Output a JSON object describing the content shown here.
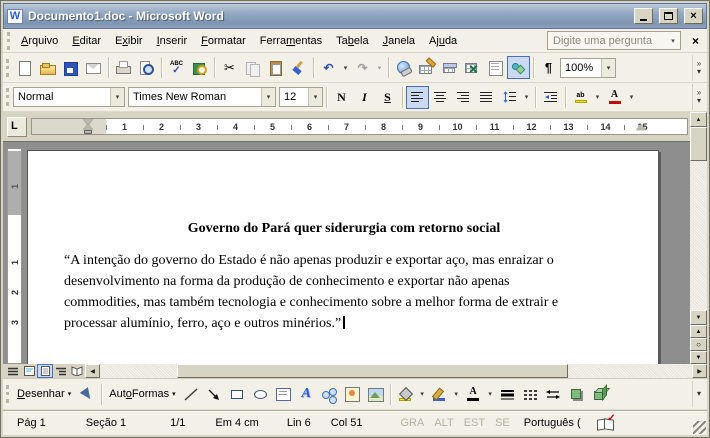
{
  "window": {
    "title": "Documento1.doc - Microsoft Word"
  },
  "icons": {
    "word_logo": "W",
    "close": "×",
    "dropdown": "▾",
    "overflow_chevron": "»",
    "cut": "✂",
    "undo": "↶",
    "redo": "↷",
    "up_arrow": "▲",
    "down_arrow": "▼",
    "left_arrow": "◀",
    "right_arrow": "▶",
    "browse_circle": "○",
    "check": "✓"
  },
  "menu_bar": {
    "items": [
      {
        "pre": "",
        "key": "A",
        "post": "rquivo"
      },
      {
        "pre": "",
        "key": "E",
        "post": "ditar"
      },
      {
        "pre": "E",
        "key": "x",
        "post": "ibir"
      },
      {
        "pre": "",
        "key": "I",
        "post": "nserir"
      },
      {
        "pre": "",
        "key": "F",
        "post": "ormatar"
      },
      {
        "pre": "Ferra",
        "key": "m",
        "post": "entas"
      },
      {
        "pre": "Ta",
        "key": "b",
        "post": "ela"
      },
      {
        "pre": "",
        "key": "J",
        "post": "anela"
      },
      {
        "pre": "Aj",
        "key": "u",
        "post": "da"
      }
    ],
    "question_placeholder": "Digite uma pergunta"
  },
  "standard_toolbar": {
    "spelling_label": "ABC",
    "pilcrow": "¶",
    "zoom_value": "100%"
  },
  "formatting_toolbar": {
    "style_value": "Normal",
    "font_value": "Times New Roman",
    "size_value": "12",
    "bold_label": "N",
    "italic_label": "I",
    "underline_label": "S",
    "highlight_label": "ab",
    "font_color_label": "A"
  },
  "ruler": {
    "tab_selector": "L",
    "numbers": [
      "1",
      "2",
      "3",
      "4",
      "5",
      "6",
      "7",
      "8",
      "9",
      "10",
      "11",
      "12",
      "13",
      "14",
      "15"
    ]
  },
  "vertical_ruler": {
    "margin_number": "1",
    "numbers": [
      "1",
      "2",
      "3"
    ]
  },
  "document": {
    "heading": "Governo do Pará quer siderurgia com retorno social",
    "paragraph_lines": [
      "“A intenção do governo do Estado é não apenas produzir e exportar aço, mas enraizar o",
      "desenvolvimento na forma da produção de conhecimento e exportar não apenas",
      "commodities, mas também tecnologia e conhecimento sobre a melhor forma de extrair e",
      "processar alumínio, ferro, aço e outros minérios.”"
    ]
  },
  "drawing_toolbar": {
    "draw": {
      "pre": "",
      "key": "D",
      "post": "esenhar"
    },
    "autoshapes": {
      "pre": "Aut",
      "key": "o",
      "post": "Formas"
    },
    "font_color_label": "A"
  },
  "status_bar": {
    "page": "Pág 1",
    "section": "Seção 1",
    "page_of_total": "1/1",
    "position": "Em 4 cm",
    "line": "Lin 6",
    "column": "Col 51",
    "modes": [
      "GRA",
      "ALT",
      "EST",
      "SE"
    ],
    "language": "Português ("
  },
  "colors": {
    "titlebar_top": "#bcc8d9",
    "titlebar_bottom": "#7e95b3",
    "toolbar_bg": "#f2f0e7",
    "document_background": "#8e8e8e",
    "selection_border": "#4a6fb5",
    "selection_fill": "#cbd9f2",
    "font_color_bar": "#c00000",
    "highlight_bar": "#ffe800"
  }
}
